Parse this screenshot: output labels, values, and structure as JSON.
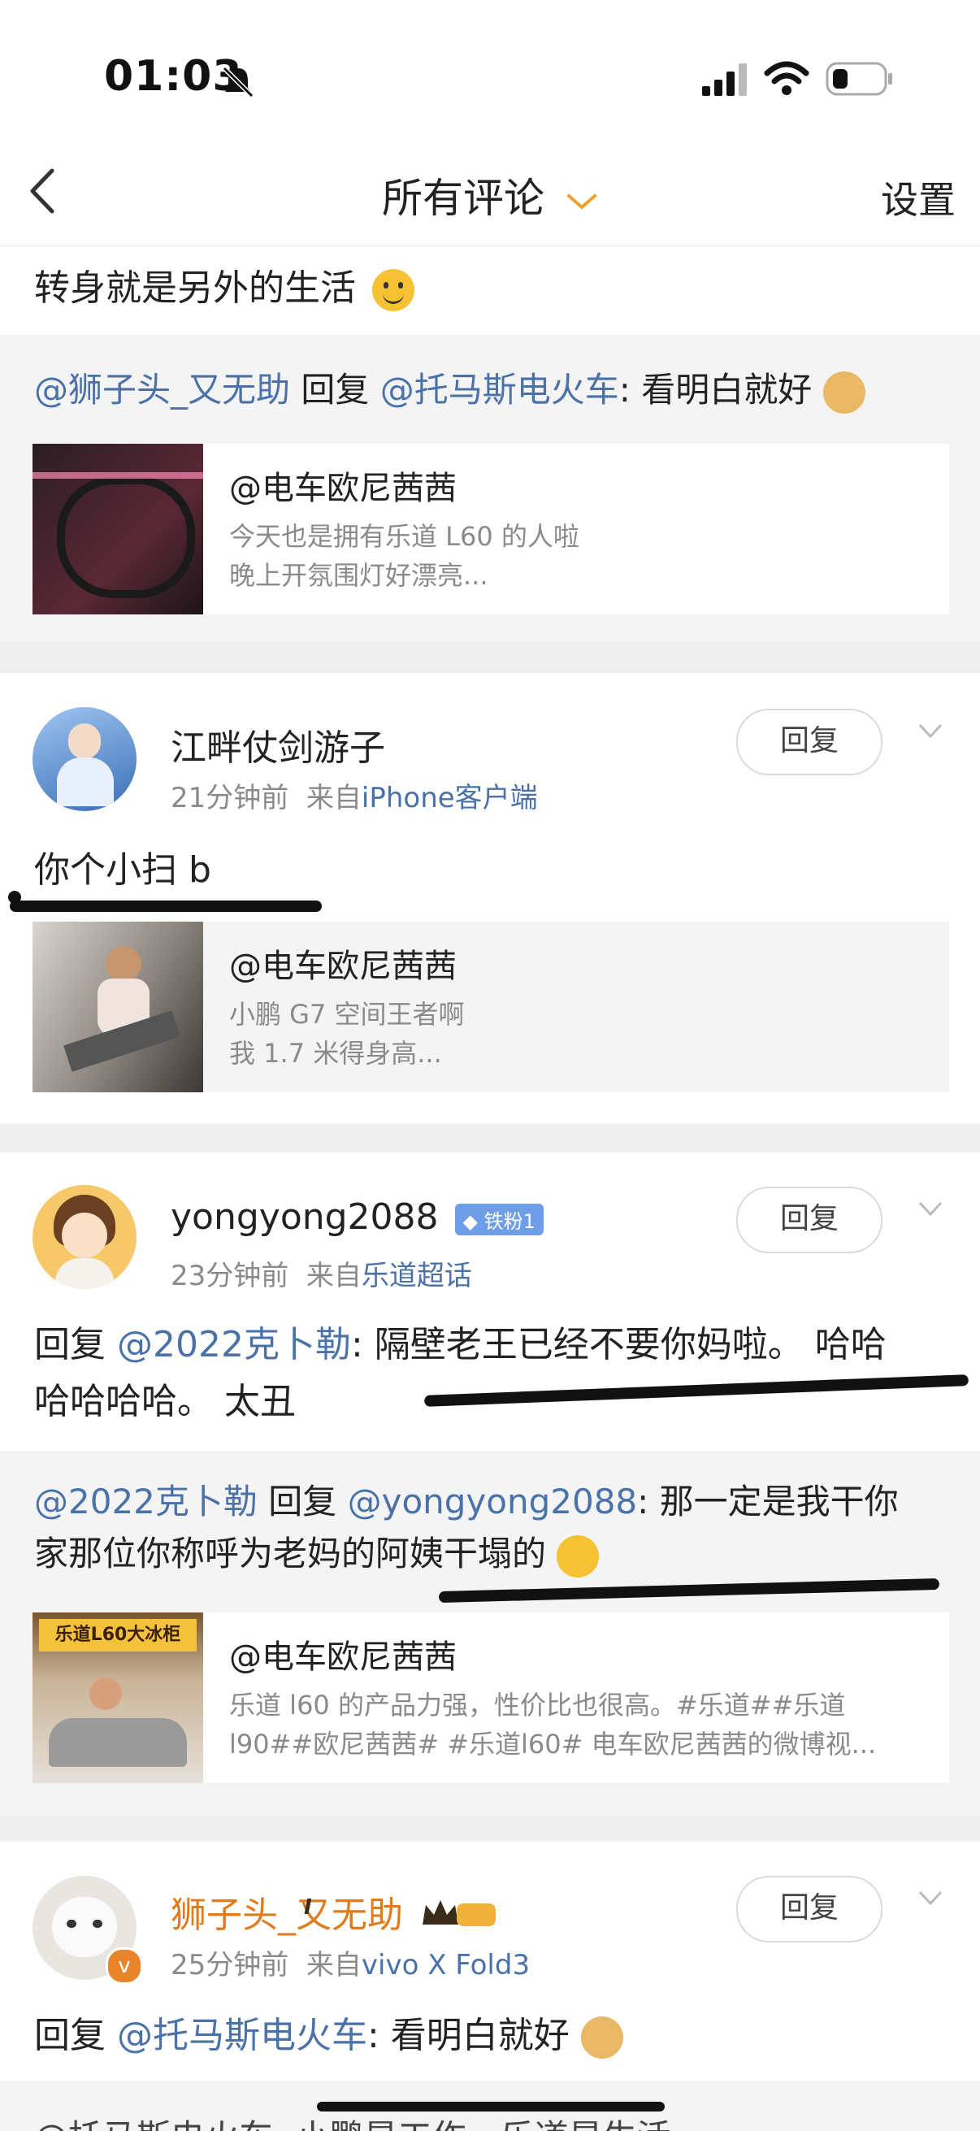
{
  "status": {
    "time": "01:03"
  },
  "nav": {
    "title": "所有评论",
    "settings": "设置"
  },
  "top_snippet": {
    "text": "转身就是另外的生活"
  },
  "reply_block_1": {
    "from": "@狮子头_又无助",
    "verb": "回复",
    "to": "@托马斯电火车",
    "content": ": 看明白就好"
  },
  "card_1": {
    "author": "@电车欧尼茜茜",
    "line1": "今天也是拥有乐道 L60 的人啦",
    "line2": "晚上开氛围灯好漂亮..."
  },
  "comment_1": {
    "username": "江畔仗剑游子",
    "time": "21分钟前",
    "source_prefix": "来自",
    "source": "iPhone客户端",
    "reply_label": "回复",
    "text": "你个小扫 b",
    "card": {
      "author": "@电车欧尼茜茜",
      "line1": "小鹏 G7 空间王者啊",
      "line2": "我 1.7 米得身高..."
    }
  },
  "comment_2": {
    "username": "yongyong2088",
    "badge": "铁粉1",
    "time": "23分钟前",
    "source_prefix": "来自",
    "source": "乐道超话",
    "reply_label": "回复",
    "text_prefix": "回复 ",
    "text_mention": "@2022克卜勒",
    "text_line1": ": 隔壁老王已经不要你妈啦。 哈哈",
    "text_line2": "哈哈哈哈。 太丑",
    "sub_reply": {
      "from": "@2022克卜勒",
      "verb": " 回复 ",
      "to": "@yongyong2088",
      "line1": ": 那一定是我干你",
      "line2": "家那位你称呼为老妈的阿姨干塌的"
    },
    "card": {
      "author": "@电车欧尼茜茜",
      "line1": "乐道 l60 的产品力强，性价比也很高。#乐道##乐道",
      "line2": "l90##欧尼茜茜# #乐道l60# 电车欧尼茜茜的微博视...",
      "thumb_text": "乐道L60大冰柜"
    }
  },
  "comment_3": {
    "username": "狮子头_又无助",
    "level": "I",
    "time": "25分钟前",
    "source_prefix": "来自",
    "source": "vivo X Fold3",
    "reply_label": "回复",
    "text_prefix": "回复 ",
    "text_mention": "@托马斯电火车",
    "text_rest": ": 看明白就好",
    "next_line": "@托马斯电火车: 小鹏是工作，乐道是生活"
  },
  "colors": {
    "link": "#4a72a8",
    "vip": "#e07b1c",
    "accent": "#f0a02a"
  }
}
